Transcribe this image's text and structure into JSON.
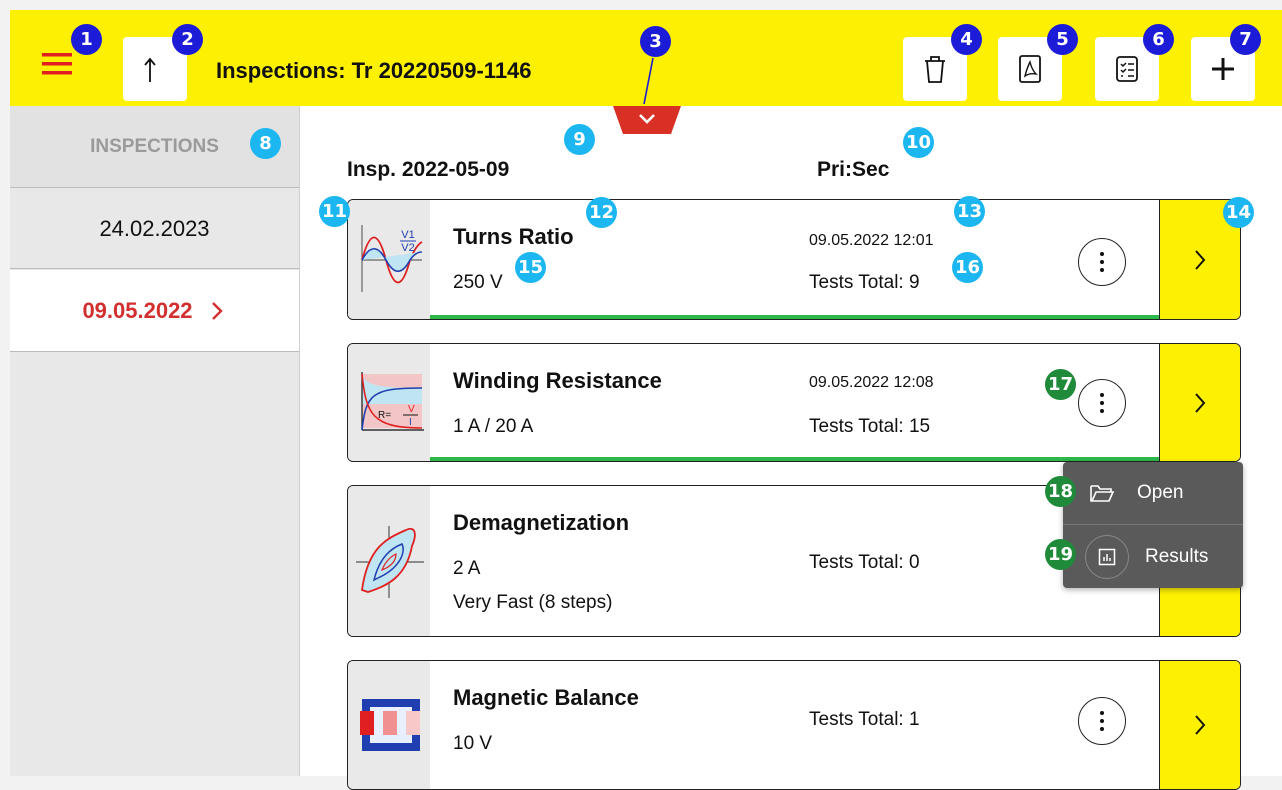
{
  "header": {
    "title": "Inspections: Tr 20220509-1146"
  },
  "sidebar": {
    "heading": "INSPECTIONS",
    "items": [
      {
        "label": "24.02.2023",
        "selected": false
      },
      {
        "label": "09.05.2022",
        "selected": true
      }
    ]
  },
  "main": {
    "column_date": "Insp. 2022-05-09",
    "column_config": "Pri:Sec",
    "tests": [
      {
        "name": "Turns Ratio",
        "param1": "250 V",
        "param2": "",
        "date": "09.05.2022 12:01",
        "total": "Tests Total: 9",
        "icon": "turns-ratio-icon"
      },
      {
        "name": "Winding Resistance",
        "param1": "1 A / 20 A",
        "param2": "",
        "date": "09.05.2022 12:08",
        "total": "Tests Total: 15",
        "icon": "winding-resistance-icon"
      },
      {
        "name": "Demagnetization",
        "param1": "2 A",
        "param2": "Very Fast (8 steps)",
        "date": "",
        "total": "Tests Total: 0",
        "icon": "demagnetization-icon"
      },
      {
        "name": "Magnetic Balance",
        "param1": "10 V",
        "param2": "",
        "date": "",
        "total": "Tests Total: 1",
        "icon": "magnetic-balance-icon"
      }
    ]
  },
  "context_menu": {
    "items": [
      {
        "label": "Open",
        "icon": "folder-open-icon"
      },
      {
        "label": "Results",
        "icon": "results-chart-icon"
      }
    ]
  },
  "callouts": [
    "1",
    "2",
    "3",
    "4",
    "5",
    "6",
    "7",
    "8",
    "9",
    "10",
    "11",
    "12",
    "13",
    "14",
    "15",
    "16",
    "17",
    "18",
    "19"
  ],
  "colors": {
    "accent_yellow": "#fdf000",
    "selected_red": "#d32f2f",
    "progress_green": "#2db84a",
    "menu_bg": "#5a5a5a"
  }
}
